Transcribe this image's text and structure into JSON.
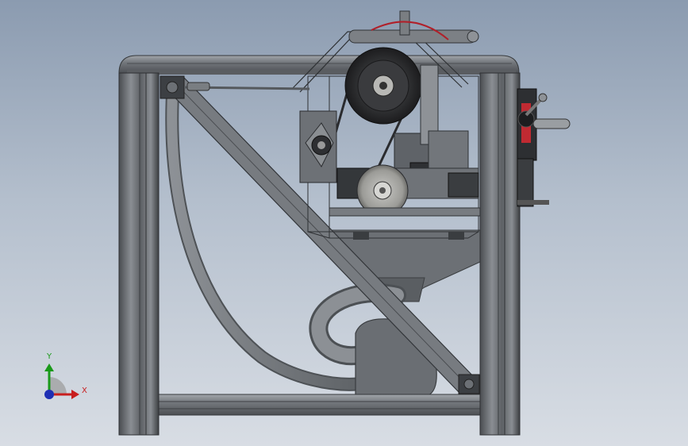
{
  "viewport": {
    "background_top": "#8b9bb0",
    "background_bottom": "#d8dde4"
  },
  "colors": {
    "frame": "#6f7378",
    "frame_dark": "#3a3d40",
    "frame_light": "#9ea3a8",
    "part_gray": "#7b7f84",
    "pulley_dark": "#2f3033",
    "accent_red": "#b0202a"
  },
  "triad": {
    "y_label": "Y",
    "x_label": "X",
    "y_color": "#1a9a1a",
    "x_color": "#c81e1e",
    "z_color": "#1e2fb4"
  }
}
